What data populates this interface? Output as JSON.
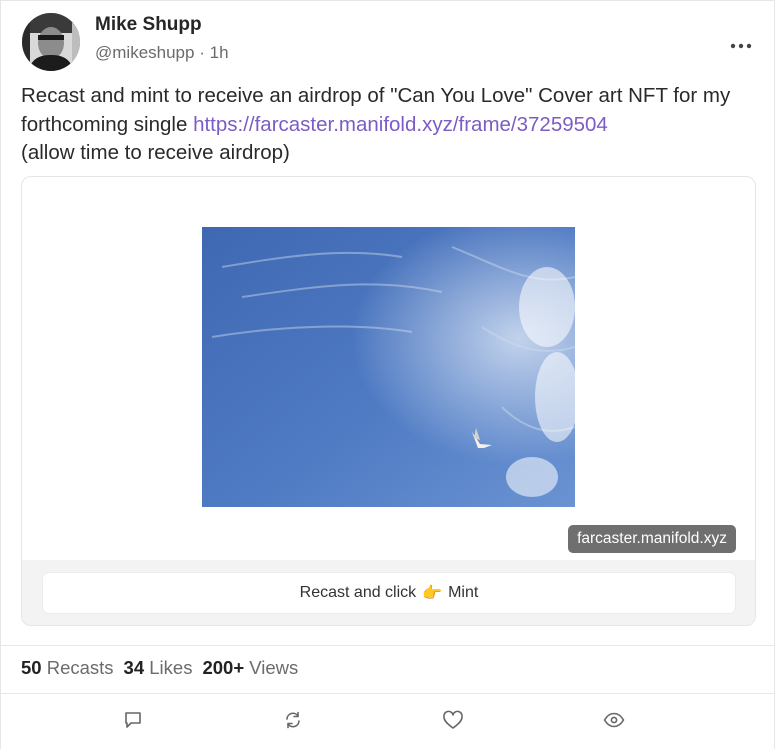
{
  "author": {
    "name": "Mike Shupp",
    "handle": "@mikeshupp",
    "separator": "·",
    "time": "1h"
  },
  "post": {
    "text_before": "Recast and mint to receive an airdrop of \"Can You Love\" Cover art NFT for my forthcoming single ",
    "link": "https://farcaster.manifold.xyz/frame/37259504",
    "text_after": " (allow time to receive airdrop)"
  },
  "frame": {
    "domain": "farcaster.manifold.xyz",
    "button_label_before": "Recast and click",
    "button_emoji": "👉",
    "button_label_after": "Mint"
  },
  "stats": {
    "recasts_count": "50",
    "recasts_label": "Recasts",
    "likes_count": "34",
    "likes_label": "Likes",
    "views_count": "200+",
    "views_label": "Views"
  },
  "icons": {
    "more": "more-horizontal-icon",
    "reply": "comment-icon",
    "recast": "recast-icon",
    "like": "heart-icon",
    "views": "eye-icon"
  },
  "colors": {
    "link": "#7c5cc4",
    "badge": "#6f6f6f",
    "sky": "#4f79c0"
  }
}
